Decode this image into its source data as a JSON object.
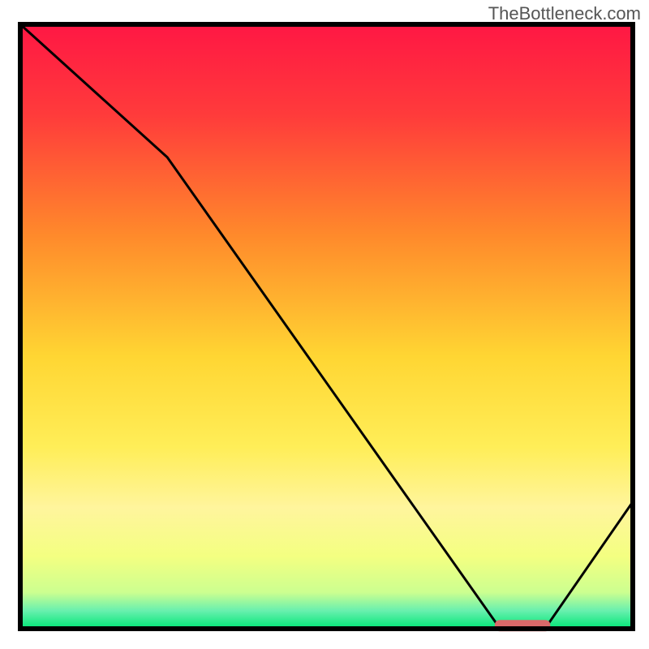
{
  "watermark": "TheBottleneck.com",
  "chart_data": {
    "type": "line",
    "title": "",
    "xlabel": "",
    "ylabel": "",
    "xlim": [
      0,
      100
    ],
    "ylim": [
      0,
      100
    ],
    "x": [
      0,
      24,
      78,
      86,
      100
    ],
    "values": [
      101,
      78,
      0.5,
      0.5,
      21
    ],
    "annotations": [],
    "background": "red-yellow-green-gradient",
    "marker": {
      "x_start": 78,
      "x_end": 86,
      "y": 0.5,
      "color": "#d96a6a"
    }
  },
  "colors": {
    "border": "#000000",
    "line": "#000000",
    "marker": "#d96a6a",
    "gradient_stops": [
      {
        "offset": 0,
        "color": "#ff1744"
      },
      {
        "offset": 15,
        "color": "#ff3b3b"
      },
      {
        "offset": 35,
        "color": "#ff8a2b"
      },
      {
        "offset": 55,
        "color": "#ffd633"
      },
      {
        "offset": 70,
        "color": "#ffee58"
      },
      {
        "offset": 80,
        "color": "#fff59d"
      },
      {
        "offset": 88,
        "color": "#f4ff81"
      },
      {
        "offset": 94,
        "color": "#ccff90"
      },
      {
        "offset": 97,
        "color": "#69f0ae"
      },
      {
        "offset": 100,
        "color": "#00e676"
      }
    ]
  }
}
